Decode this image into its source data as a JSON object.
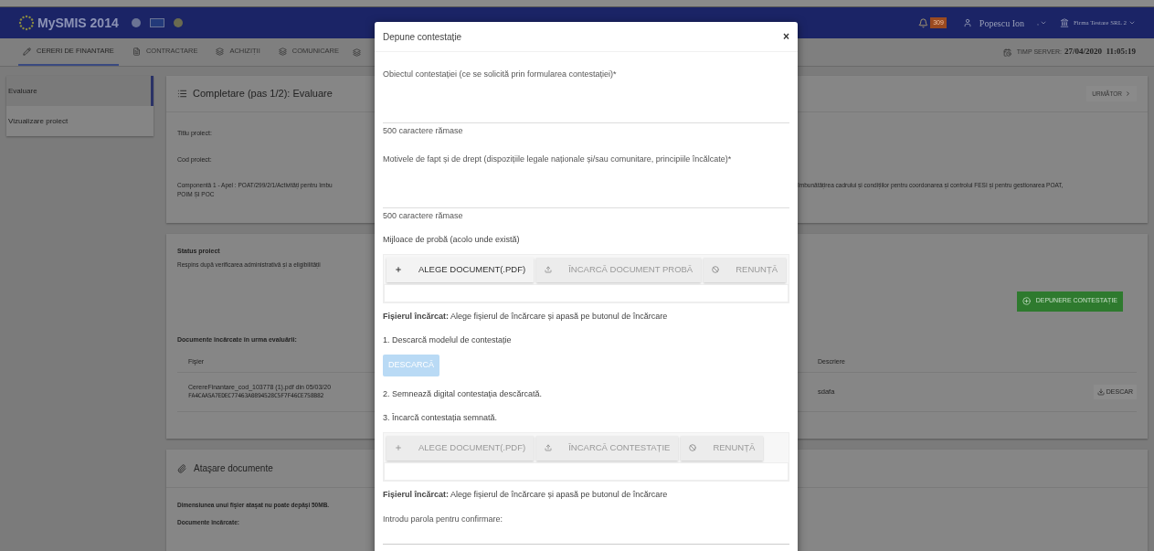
{
  "header": {
    "logo": "MySMIS 2014",
    "badge": "309",
    "user_name": "Popescu Ion",
    "user_extra": ",",
    "company": "Firma Testare SRL 2"
  },
  "nav_tabs": [
    {
      "label": "CERERI DE FINANTARE",
      "selected": true
    },
    {
      "label": "CONTRACTARE",
      "selected": false
    },
    {
      "label": "ACHIZIȚII",
      "selected": false
    },
    {
      "label": "COMUNICARE",
      "selected": false
    }
  ],
  "server_time": {
    "label": "TIMP SERVER:",
    "value": "27/04/2020  11:05:19"
  },
  "sidebar": {
    "items": [
      {
        "label": "Evaluare",
        "selected": true
      },
      {
        "label": "Vizualizare proiect",
        "selected": false
      }
    ]
  },
  "step_card": {
    "title": "Completare (pas 1/2): Evaluare",
    "next_button": "URMĂTOR",
    "fields": [
      "Titlu proiect:",
      "Cod proiect:"
    ],
    "component": {
      "left_lines": [
        "Componentă 1 - Apel : POAT/299/2/1/Activități pentru îmbu",
        "POIM ȘI POC"
      ],
      "right_text": "îmbunătățirea cadrului și condițiilor pentru coordonarea și controlul FESI și pentru gestionarea POAT,"
    }
  },
  "status_card": {
    "title": "Status proiect",
    "status": "Respins după verificarea administrativă și a eligibilității",
    "appeal_button": "DEPUNERE CONTESTAȚIE",
    "documents_title": "Documente încărcate în urma evaluării:",
    "table": {
      "columns": [
        "Fişier",
        "Descriere"
      ],
      "rows": [
        {
          "file_lines": [
            "CerereFinantare_cod_103778 (1).pdf din 05/03/20",
            "FA4CAA5A7EDEC77463A0894528C5F7F46CE758B82"
          ],
          "description": "sdafa",
          "action": "DESCAR"
        }
      ]
    }
  },
  "attach_card": {
    "title": "Ataşare documente",
    "note": "Dimensiunea unui fişier ataşat nu poate depăşi 50MB.",
    "uploaded_title": "Documente încărcate:"
  },
  "modal": {
    "title": "Depune contestație",
    "close": "×",
    "sections": [
      {
        "kind": "textarea",
        "label": "Obiectul contestației (ce se solicită prin formularea contestației)*",
        "counter": "500 caractere rămase"
      },
      {
        "kind": "textarea",
        "label": "Motivele de fapt și de drept (dispozițiile legale naționale și/sau comunitare, principiile încălcate)*",
        "counter": "500 caractere rămase"
      },
      {
        "kind": "text",
        "label": "Mijloace de probă (acolo unde există)"
      },
      {
        "kind": "upload",
        "buttons": [
          {
            "label": "ALEGE DOCUMENT(.PDF)",
            "disabled": false
          },
          {
            "label": "ÎNCARCĂ DOCUMENT PROBĂ",
            "disabled": true
          },
          {
            "label": "RENUNȚĂ",
            "disabled": true
          }
        ]
      },
      {
        "kind": "text",
        "label": "**Fișierul încărcat:** Alege fișierul de încărcare și apasă pe butonul de încărcare"
      },
      {
        "kind": "text",
        "label": "1. Descarcă modelul de contestație"
      },
      {
        "kind": "button",
        "label": "DESCARCĂ",
        "disabled": true
      },
      {
        "kind": "text",
        "label": "2. Semnează digital contestația descărcată."
      },
      {
        "kind": "text",
        "label": "3. Încarcă contestația semnată."
      },
      {
        "kind": "upload",
        "buttons": [
          {
            "label": "ALEGE DOCUMENT(.PDF)",
            "disabled": true
          },
          {
            "label": "ÎNCARCĂ CONTESTAȚIE",
            "disabled": true
          },
          {
            "label": "RENUNȚĂ",
            "disabled": true
          }
        ]
      },
      {
        "kind": "text",
        "label": "**Fișierul încărcat:** Alege fișierul de încărcare și apasă pe butonul de încărcare"
      },
      {
        "kind": "password",
        "label": "Introdu parola pentru confirmare:"
      }
    ]
  }
}
